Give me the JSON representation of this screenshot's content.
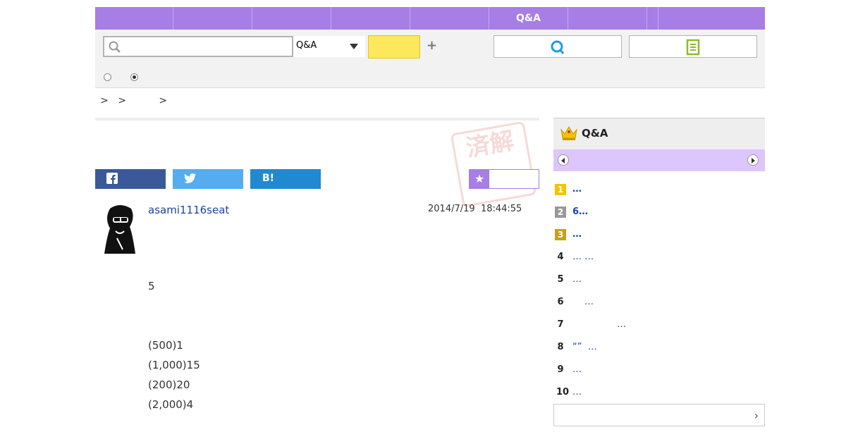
{
  "nav": {
    "items": [
      "",
      "",
      "",
      "",
      "",
      "Q&A",
      "",
      "",
      ""
    ]
  },
  "search": {
    "placeholder": "",
    "category_selected": "Q&A",
    "button_label": ""
  },
  "toolbar": {
    "plus_label": "+",
    "ask_button_label": "",
    "doc_button_label": ""
  },
  "radios": [
    {
      "label": "",
      "selected": false
    },
    {
      "label": "",
      "selected": true
    }
  ],
  "breadcrumb": [
    ">",
    ">",
    ">"
  ],
  "stamp_text": "済解",
  "share": {
    "facebook": "",
    "twitter": "",
    "hatena": "B!",
    "favorite": ""
  },
  "post": {
    "username": "asami1116seat",
    "date": "2014/7/19",
    "time": "18:44:55",
    "lines": [
      "5",
      "(500)1",
      "(1,000)15",
      "(200)20",
      "(2,000)4"
    ]
  },
  "sidebar": {
    "title": "Q&A",
    "rankings": [
      {
        "rank": "1",
        "text": "…"
      },
      {
        "rank": "2",
        "text": "6…"
      },
      {
        "rank": "3",
        "text": "…"
      },
      {
        "rank": "4",
        "text": "… …"
      },
      {
        "rank": "5",
        "text": "…"
      },
      {
        "rank": "6",
        "text": "…"
      },
      {
        "rank": "7",
        "text": "…"
      },
      {
        "rank": "8",
        "text": "“”  …"
      },
      {
        "rank": "9",
        "text": "…"
      },
      {
        "rank": "10",
        "text": "…"
      }
    ],
    "more_label": ""
  },
  "colors": {
    "nav": "#a77de6",
    "search_button": "#fde75b",
    "link": "#1a44a8",
    "rank1": "#f5c400",
    "rank2": "#999999",
    "rank3": "#c8a018"
  }
}
